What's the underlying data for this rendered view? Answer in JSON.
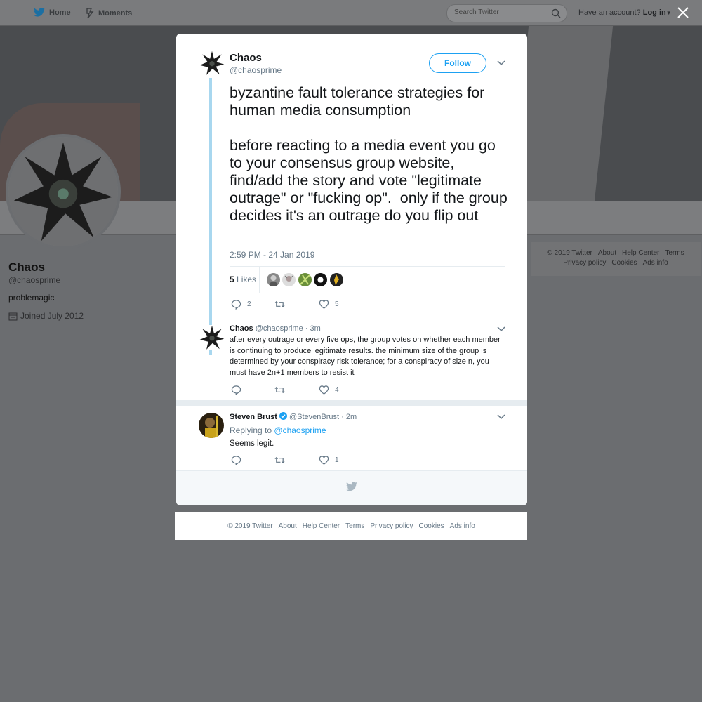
{
  "nav": {
    "home": "Home",
    "moments": "Moments",
    "search_placeholder": "Search Twitter",
    "have_account": "Have an account?",
    "login": "Log in"
  },
  "profile": {
    "name": "Chaos",
    "handle": "@chaosprime",
    "bio": "problemagic",
    "joined": "Joined July 2012"
  },
  "side_footer": [
    "© 2019 Twitter",
    "About",
    "Help Center",
    "Terms",
    "Privacy policy",
    "Cookies",
    "Ads info"
  ],
  "main_tweet": {
    "name": "Chaos",
    "handle": "@chaosprime",
    "follow_label": "Follow",
    "text": "byzantine fault tolerance strategies for human media consumption\n\nbefore reacting to a media event you go to your consensus group website, find/add the story and vote \"legitimate outrage\" or \"fucking op\".  only if the group decides it's an outrage do you flip out",
    "timestamp": "2:59 PM - 24 Jan 2019",
    "likes_count": "5",
    "likes_label": "Likes",
    "reply_count": "2",
    "retweet_count": "",
    "like_count": "5"
  },
  "reply1": {
    "name": "Chaos",
    "handle": "@chaosprime",
    "time": "· 3m",
    "text": "after every outrage or every five ops, the group votes on whether each member is continuing to produce legitimate results.  the minimum size of the group is determined by your conspiracy risk tolerance; for a conspiracy of size n, you must have 2n+1 members to resist it",
    "reply_count": "",
    "retweet_count": "",
    "like_count": "4"
  },
  "reply2": {
    "name": "Steven Brust",
    "handle": "@StevenBrust",
    "time": "· 2m",
    "replying_to_prefix": "Replying to",
    "replying_to": "@chaosprime",
    "text": "Seems legit.",
    "reply_count": "",
    "retweet_count": "",
    "like_count": "1"
  },
  "bottom_footer": [
    "© 2019 Twitter",
    "About",
    "Help Center",
    "Terms",
    "Privacy policy",
    "Cookies",
    "Ads info"
  ],
  "colors": {
    "twitter_blue": "#1da1f2",
    "thread_line": "#a8d7ef",
    "overlay": "#6b6d70"
  }
}
